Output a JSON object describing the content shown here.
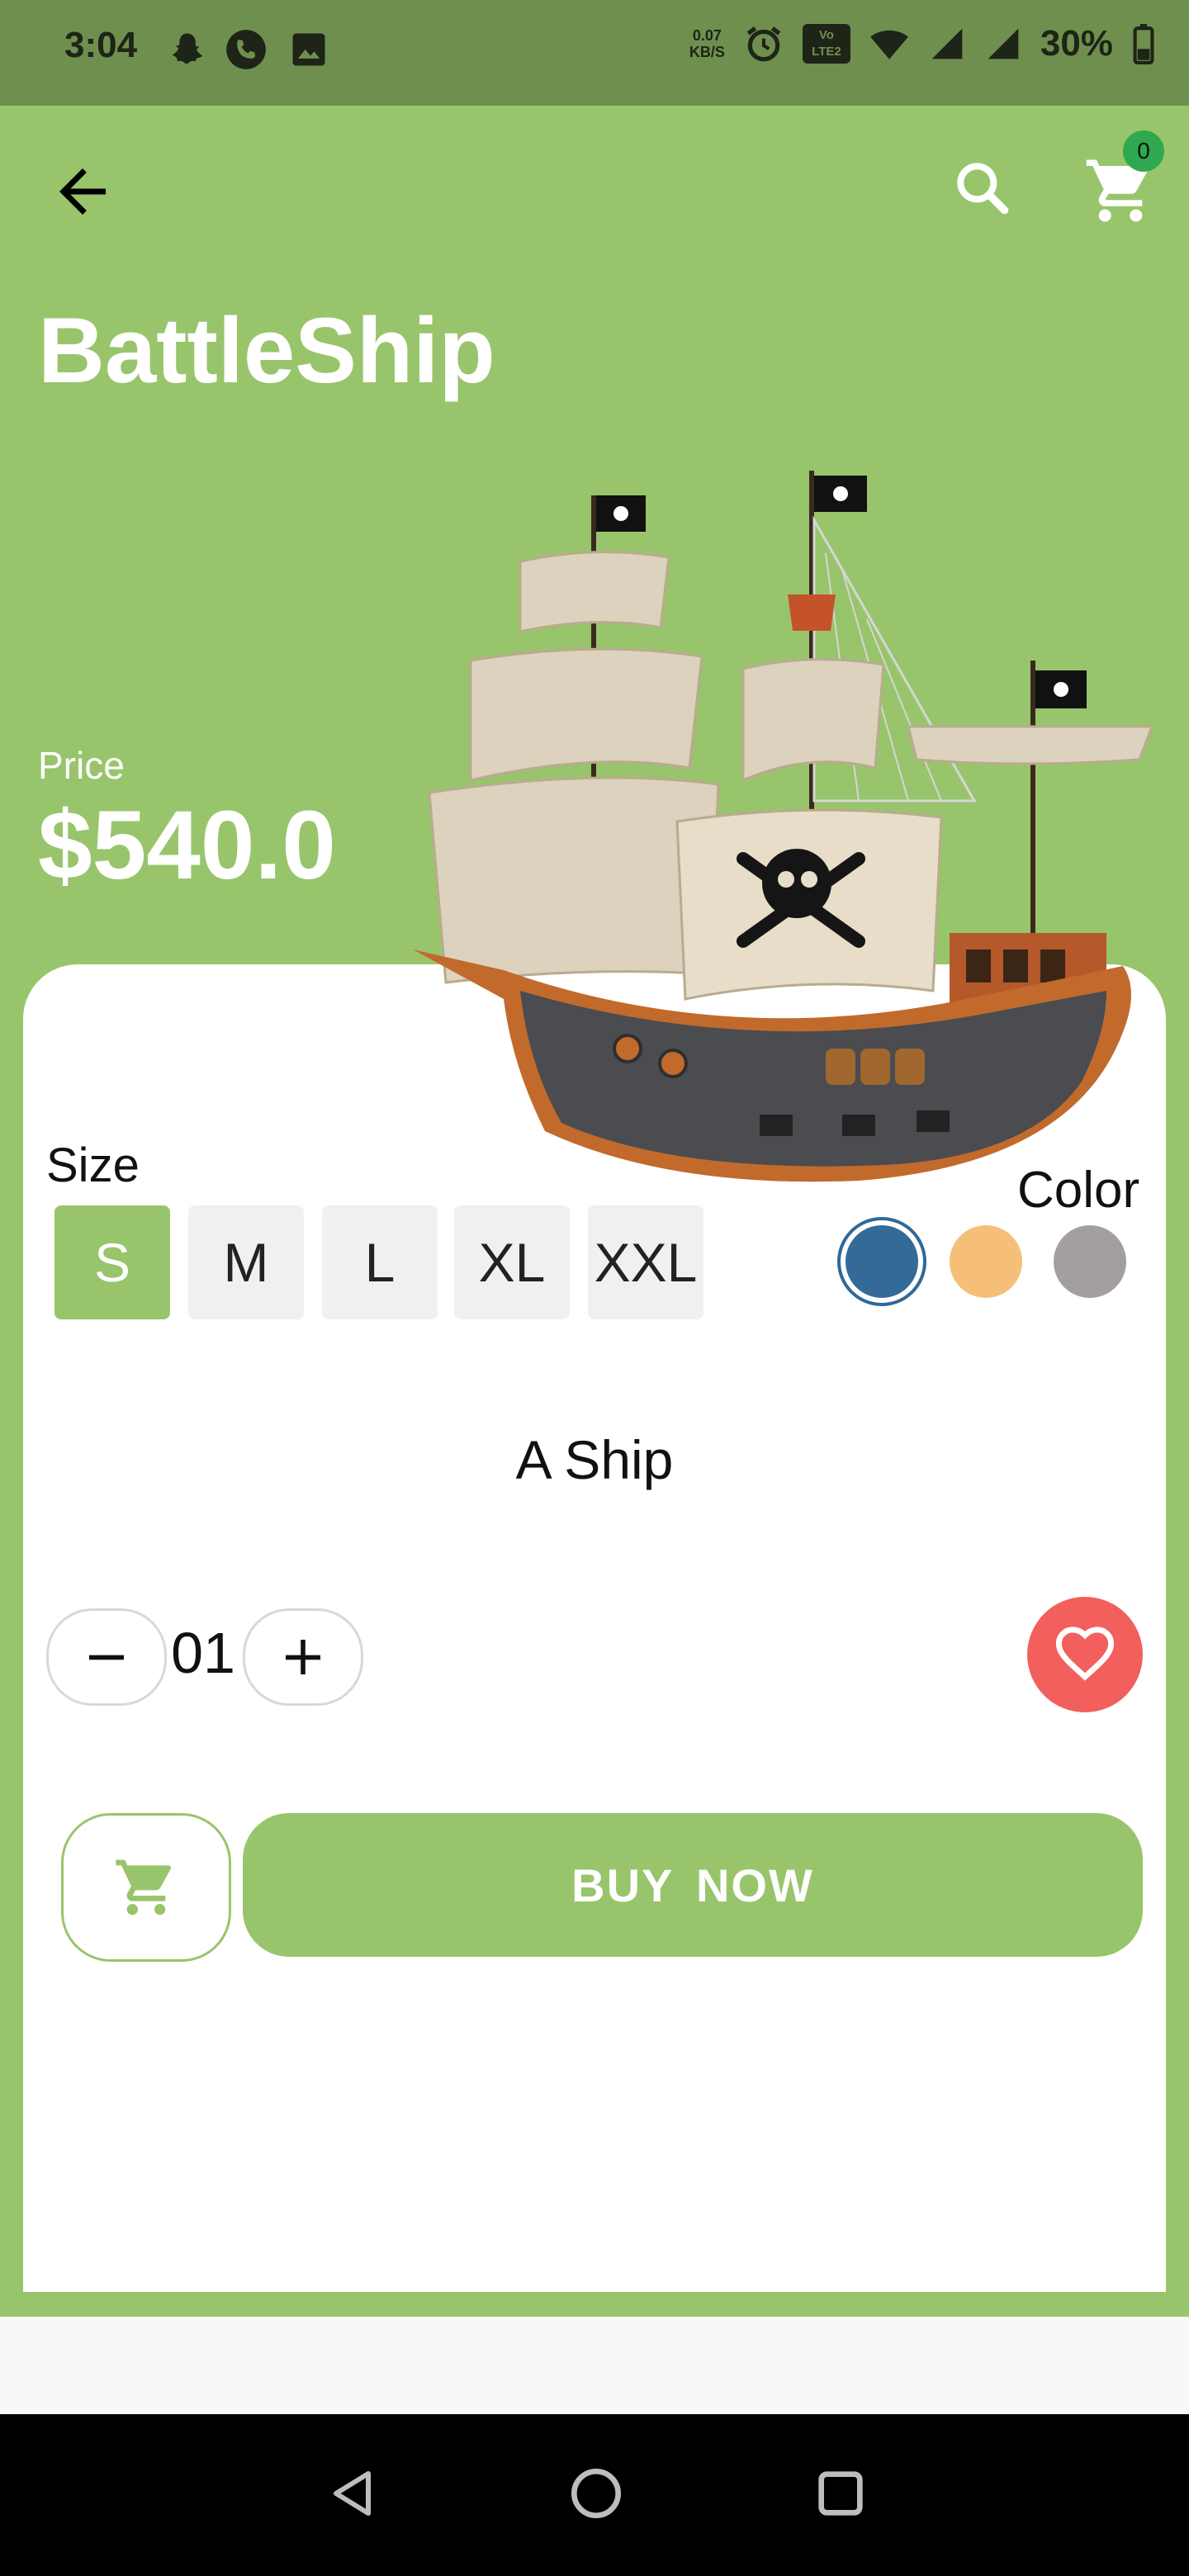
{
  "status_bar": {
    "time": "3:04",
    "net_speed_value": "0.07",
    "net_speed_unit": "KB/S",
    "lte_label": "LTE2",
    "battery": "30%"
  },
  "header": {
    "cart_count": "0",
    "product_title": "BattleShip"
  },
  "price": {
    "label": "Price",
    "value": "$540.0"
  },
  "sizes": {
    "label": "Size",
    "options": [
      "S",
      "M",
      "L",
      "XL",
      "XXL"
    ],
    "selected": "S"
  },
  "colors": {
    "label": "Color",
    "swatches": [
      "#336a97",
      "#f6bf79",
      "#a39fa0"
    ],
    "selected_index": 0
  },
  "description": "A Ship",
  "quantity": {
    "value": "01"
  },
  "actions": {
    "buy_label": "BUY  NOW"
  },
  "theme": {
    "accent": "#98c56b",
    "favorite": "#f25f5c"
  }
}
